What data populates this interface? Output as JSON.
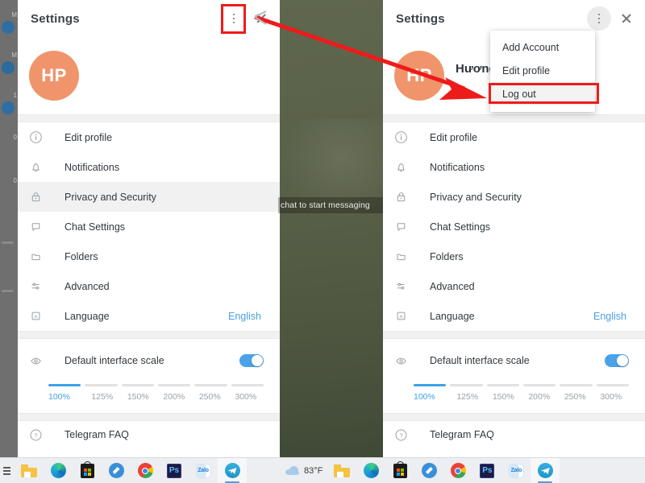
{
  "panel": {
    "title": "Settings",
    "avatar_initials": "HP",
    "avatar_color": "#f0956b",
    "profile_name": "Hương",
    "profile_phone": "+84 ...",
    "accent_color": "#3fa2e6",
    "highlight_color": "#ee1b1b",
    "items": [
      {
        "label": "Edit profile",
        "icon": "info-circle-icon",
        "value": ""
      },
      {
        "label": "Notifications",
        "icon": "bell-icon",
        "value": ""
      },
      {
        "label": "Privacy and Security",
        "icon": "lock-icon",
        "value": ""
      },
      {
        "label": "Chat Settings",
        "icon": "chat-bubble-icon",
        "value": ""
      },
      {
        "label": "Folders",
        "icon": "folder-icon",
        "value": ""
      },
      {
        "label": "Advanced",
        "icon": "sliders-icon",
        "value": ""
      },
      {
        "label": "Language",
        "icon": "language-icon",
        "value": "English"
      }
    ],
    "scale": {
      "label": "Default interface scale",
      "icon": "eye-icon",
      "toggle_on": true,
      "selected": "100%",
      "options": [
        "100%",
        "125%",
        "150%",
        "200%",
        "250%",
        "300%"
      ]
    },
    "faq": {
      "label": "Telegram FAQ",
      "icon": "question-circle-icon"
    }
  },
  "menu": {
    "items": [
      {
        "label": "Add Account",
        "highlighted": false
      },
      {
        "label": "Edit profile",
        "highlighted": false
      },
      {
        "label": "Log out",
        "highlighted": true
      }
    ]
  },
  "chat_area": {
    "hint": "chat to start messaging"
  },
  "taskbar": {
    "weather_temp": "83°F",
    "weather_icon": "cloud-icon",
    "apps": [
      {
        "name": "file-explorer",
        "label": "File Explorer"
      },
      {
        "name": "microsoft-edge",
        "label": "Microsoft Edge"
      },
      {
        "name": "microsoft-store",
        "label": "Microsoft Store"
      },
      {
        "name": "blue-app",
        "label": "App"
      },
      {
        "name": "google-chrome",
        "label": "Google Chrome"
      },
      {
        "name": "photoshop",
        "label": "Ps"
      },
      {
        "name": "zalo",
        "label": "Zalo"
      },
      {
        "name": "telegram",
        "label": "Telegram"
      }
    ]
  },
  "sidebar_sliver": {
    "rows": [
      "M",
      "M",
      "1",
      "0",
      "0"
    ]
  }
}
